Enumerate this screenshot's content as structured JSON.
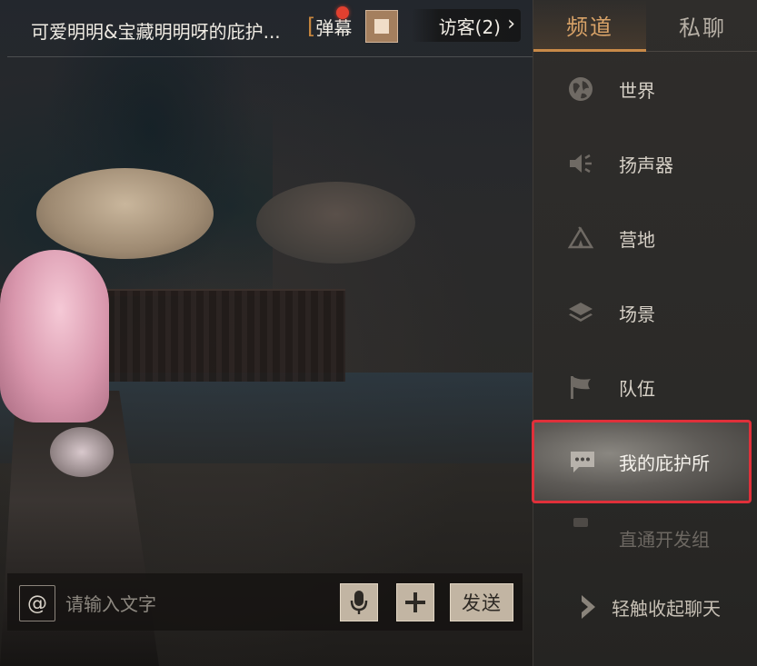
{
  "header": {
    "room_title": "可爱明明&宝藏明明呀的庇护...",
    "danmu_label": "弹幕",
    "visitor_label": "访客(2)"
  },
  "input": {
    "at_symbol": "@",
    "placeholder": "请输入文字",
    "send_label": "发送"
  },
  "panel": {
    "tabs": [
      {
        "label": "频道",
        "active": true
      },
      {
        "label": "私聊",
        "active": false
      }
    ],
    "channels": [
      {
        "label": "世界",
        "icon": "globe-icon"
      },
      {
        "label": "扬声器",
        "icon": "speaker-icon"
      },
      {
        "label": "营地",
        "icon": "camp-tent-icon"
      },
      {
        "label": "场景",
        "icon": "layers-icon"
      },
      {
        "label": "队伍",
        "icon": "flag-icon"
      },
      {
        "label": "我的庇护所",
        "icon": "chat-bubble-icon",
        "selected": true
      },
      {
        "label": "直通开发组",
        "icon": "dev-icon"
      }
    ],
    "collapse_label": "轻触收起聊天"
  },
  "colors": {
    "accent": "#d9a368",
    "selection_border": "#e0303a",
    "notification_dot": "#e2402f",
    "button_fill": "#c2b5a3"
  }
}
